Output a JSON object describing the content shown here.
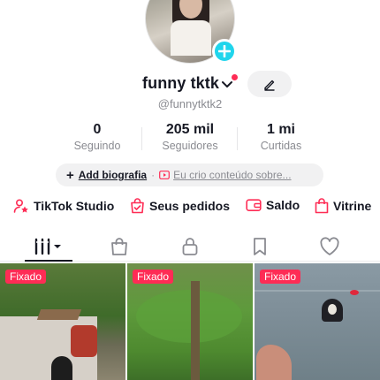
{
  "profile": {
    "display_name": "funny tktk",
    "username": "@funnytktk2",
    "add_icon": "plus-icon",
    "notification_dot_color": "#fe2c55"
  },
  "stats": [
    {
      "value": "0",
      "label": "Seguindo"
    },
    {
      "value": "205 mil",
      "label": "Seguidores"
    },
    {
      "value": "1 mi",
      "label": "Curtidas"
    }
  ],
  "bio": {
    "add_label": "Add biografia",
    "separator": "·",
    "creator_label": "Eu crio conteúdo sobre..."
  },
  "shortcuts": [
    {
      "label": "TikTok Studio",
      "icon": "studio-icon"
    },
    {
      "label": "Seus pedidos",
      "icon": "orders-icon"
    },
    {
      "label": "Saldo",
      "icon": "wallet-icon"
    },
    {
      "label": "Vitrine",
      "icon": "shopping-bag-icon"
    }
  ],
  "tabs": [
    {
      "name": "videos",
      "icon": "grid-icon",
      "active": true
    },
    {
      "name": "shop",
      "icon": "bag-icon"
    },
    {
      "name": "private",
      "icon": "lock-icon"
    },
    {
      "name": "saved",
      "icon": "bookmark-icon"
    },
    {
      "name": "liked",
      "icon": "heart-icon"
    }
  ],
  "videos": [
    {
      "badge": "Fixado"
    },
    {
      "badge": "Fixado"
    },
    {
      "badge": "Fixado"
    }
  ],
  "colors": {
    "accent": "#fe2c55",
    "add_badge": "#20d5ec",
    "muted_text": "#8a8b91"
  }
}
